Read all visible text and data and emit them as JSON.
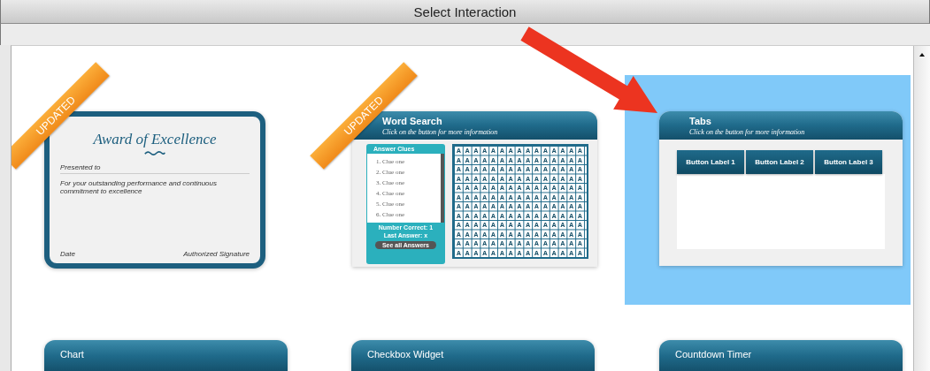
{
  "window": {
    "title": "Select Interaction"
  },
  "interactions": [
    {
      "kind": "certificate",
      "updated": true,
      "updated_label": "UPDATED",
      "selected": false,
      "title": "Award of Excellence",
      "presented": "Presented to",
      "body": "For your outstanding performance and continuous commitment to excellence",
      "date": "Date",
      "signature": "Authorized Signature"
    },
    {
      "kind": "word_search",
      "updated": true,
      "updated_label": "UPDATED",
      "selected": false,
      "title": "Word Search",
      "subtitle": "Click on the button for more information",
      "clues_title": "Answer Clues",
      "clues": [
        "1. Clue one",
        "2. Clue one",
        "3. Clue one",
        "4. Clue one",
        "5. Clue one",
        "6. Clue one"
      ],
      "score": "Number Correct: 1",
      "last_answer": "Last Answer: x",
      "answers_button": "See all Answers",
      "grid": [
        "AAAAAAAAAAAAAAA",
        "AAAAAAAAAAAAAAA",
        "AAAAAAAAAAAAAAA",
        "AAAAAAAAAAAAAAA",
        "AAAAAAAAAAAAAAA",
        "AAAAAAAAAAAAAAA",
        "AAAAAAAAAAAAAAA",
        "AAAAAAAAAAAAAAA",
        "AAAAAAAAAAAAAAA",
        "AAAAAAAAAAAAAAA",
        "AAAAAAAAAAAAAAA",
        "AAAAAAAAAAAAAAA"
      ]
    },
    {
      "kind": "tabs",
      "updated": false,
      "selected": true,
      "title": "Tabs",
      "subtitle": "Click on the button for more information",
      "tab_buttons": [
        "Button Label 1",
        "Button Label 2",
        "Button Label 3"
      ]
    },
    {
      "kind": "header",
      "updated": false,
      "selected": false,
      "title": "Chart"
    },
    {
      "kind": "header",
      "updated": false,
      "selected": false,
      "title": "Checkbox Widget"
    },
    {
      "kind": "header",
      "updated": false,
      "selected": false,
      "title": "Countdown Timer"
    }
  ]
}
